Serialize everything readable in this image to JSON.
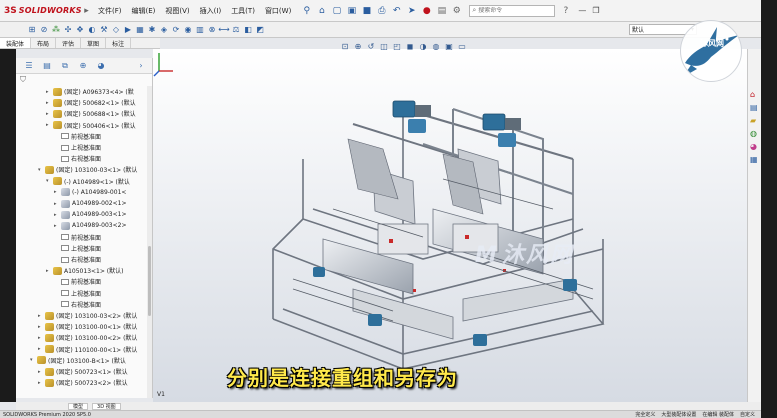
{
  "app": {
    "logo_mark": "3S",
    "logo_text": "SOLIDWORKS"
  },
  "menu": {
    "items": [
      "文件(F)",
      "编辑(E)",
      "视图(V)",
      "插入(I)",
      "工具(T)",
      "窗口(W)"
    ]
  },
  "search": {
    "placeholder": "搜索命令"
  },
  "config": {
    "value": "默认"
  },
  "command_tabs": [
    "装配体",
    "布局",
    "评估",
    "草图",
    "标注"
  ],
  "tree": [
    {
      "level": 4,
      "arrow": "▸",
      "icon": "asm",
      "label": "(固定) A096373<4> (默"
    },
    {
      "level": 4,
      "arrow": "▸",
      "icon": "asm",
      "label": "(固定) 500682<1> (默认"
    },
    {
      "level": 4,
      "arrow": "▸",
      "icon": "asm",
      "label": "(固定) 500688<1> (默认"
    },
    {
      "level": 4,
      "arrow": "▸",
      "icon": "asm",
      "label": "(固定) 500406<1> (默认"
    },
    {
      "level": 5,
      "arrow": "",
      "icon": "plane",
      "label": "前视基准面"
    },
    {
      "level": 5,
      "arrow": "",
      "icon": "plane",
      "label": "上视基准面"
    },
    {
      "level": 5,
      "arrow": "",
      "icon": "plane",
      "label": "右视基准面"
    },
    {
      "level": 3,
      "arrow": "▾",
      "icon": "asm",
      "label": "(固定) 103100-03<1> (默认"
    },
    {
      "level": 4,
      "arrow": "▾",
      "icon": "asm",
      "label": "(-) A104989<1> (默认"
    },
    {
      "level": 5,
      "arrow": "▸",
      "icon": "part",
      "label": "(-) A104989-001<"
    },
    {
      "level": 5,
      "arrow": "▸",
      "icon": "part",
      "label": "A104989-002<1>"
    },
    {
      "level": 5,
      "arrow": "▸",
      "icon": "part",
      "label": "A104989-003<1>"
    },
    {
      "level": 5,
      "arrow": "▸",
      "icon": "part",
      "label": "A104989-003<2>"
    },
    {
      "level": 5,
      "arrow": "",
      "icon": "plane",
      "label": "前视基准面"
    },
    {
      "level": 5,
      "arrow": "",
      "icon": "plane",
      "label": "上视基准面"
    },
    {
      "level": 5,
      "arrow": "",
      "icon": "plane",
      "label": "右视基准面"
    },
    {
      "level": 4,
      "arrow": "▸",
      "icon": "asm",
      "label": "A105013<1> (默认)"
    },
    {
      "level": 5,
      "arrow": "",
      "icon": "plane",
      "label": "前视基准面"
    },
    {
      "level": 5,
      "arrow": "",
      "icon": "plane",
      "label": "上视基准面"
    },
    {
      "level": 5,
      "arrow": "",
      "icon": "plane",
      "label": "右视基准面"
    },
    {
      "level": 3,
      "arrow": "▸",
      "icon": "asm",
      "label": "(固定) 103100-03<2> (默认"
    },
    {
      "level": 3,
      "arrow": "▸",
      "icon": "asm",
      "label": "(固定) 103100-00<1> (默认"
    },
    {
      "level": 3,
      "arrow": "▸",
      "icon": "asm",
      "label": "(固定) 103100-00<2> (默认"
    },
    {
      "level": 3,
      "arrow": "▸",
      "icon": "asm",
      "label": "(固定) 110100-00<1> (默认"
    },
    {
      "level": 2,
      "arrow": "▾",
      "icon": "asm",
      "label": "(固定) 103100-B<1> (默认"
    },
    {
      "level": 3,
      "arrow": "▸",
      "icon": "asm",
      "label": "(固定) 500723<1> (默认"
    },
    {
      "level": 3,
      "arrow": "▸",
      "icon": "asm",
      "label": "(固定) 500723<2> (默认"
    }
  ],
  "viewport": {
    "view_label": "V1",
    "watermark_center": "沐风网"
  },
  "watermark_logo": {
    "text": "沐风网"
  },
  "subtitle": "分别是连接重组和另存为",
  "model_tabs": [
    "模型",
    "3D 视图"
  ],
  "status": {
    "left": "SOLIDWORKS Premium 2020 SP5.0",
    "right": [
      "完全定义",
      "大型装配体设置",
      "在编辑 装配体",
      "自定义"
    ]
  }
}
